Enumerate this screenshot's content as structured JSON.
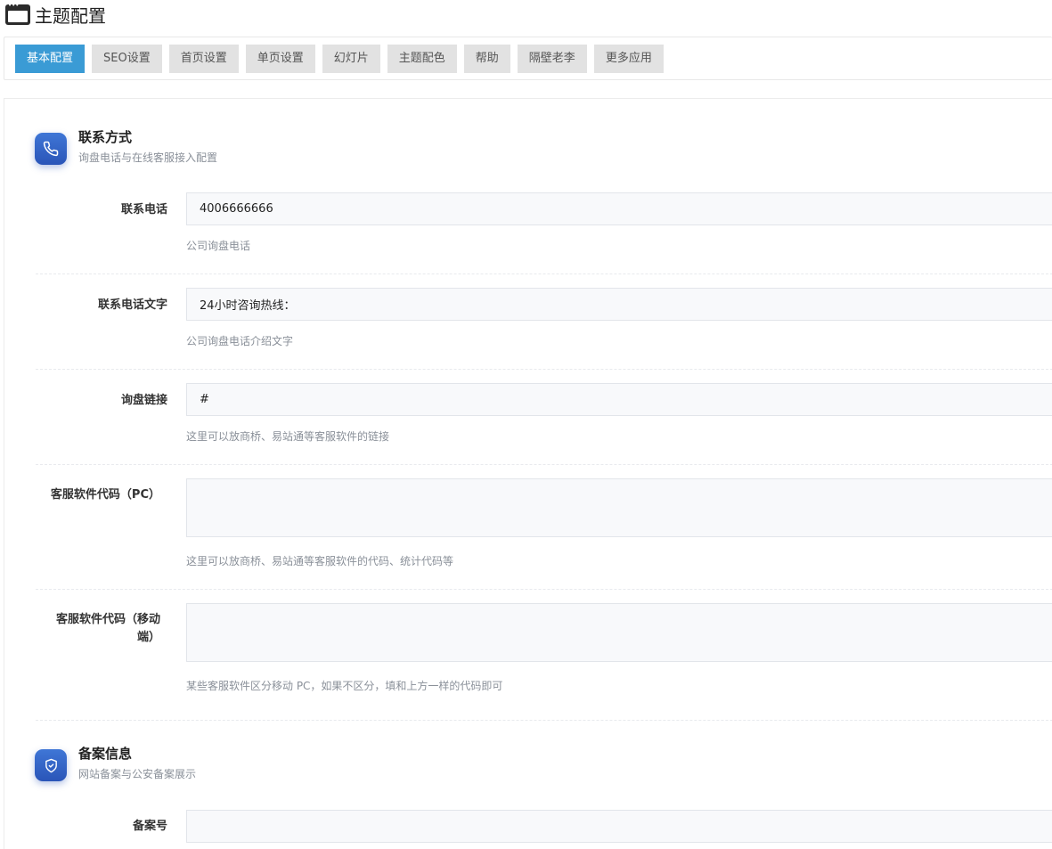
{
  "page": {
    "title": "主题配置",
    "icon": "browser-window-icon"
  },
  "tabs": [
    {
      "label": "基本配置",
      "active": true
    },
    {
      "label": "SEO设置"
    },
    {
      "label": "首页设置"
    },
    {
      "label": "单页设置"
    },
    {
      "label": "幻灯片"
    },
    {
      "label": "主题配色"
    },
    {
      "label": "帮助"
    },
    {
      "label": "隔壁老李"
    },
    {
      "label": "更多应用"
    }
  ],
  "sections": {
    "contact": {
      "title": "联系方式",
      "desc": "询盘电话与在线客服接入配置",
      "icon": "phone-icon"
    },
    "record": {
      "title": "备案信息",
      "desc": "网站备案与公安备案展示",
      "icon": "shield-check-icon"
    }
  },
  "fields": {
    "phone": {
      "label": "联系电话",
      "value": "4006666666",
      "hint": "公司询盘电话"
    },
    "phone_text": {
      "label": "联系电话文字",
      "value": "24小时咨询热线：",
      "hint": "公司询盘电话介绍文字"
    },
    "inquiry_link": {
      "label": "询盘链接",
      "value": "#",
      "hint": "这里可以放商桥、易站通等客服软件的链接"
    },
    "cs_code_pc": {
      "label": "客服软件代码（PC）",
      "value": "",
      "hint": "这里可以放商桥、易站通等客服软件的代码、统计代码等"
    },
    "cs_code_mobile": {
      "label_line1": "客服软件代码（移动",
      "label_line2": "端）",
      "value": "",
      "hint": "某些客服软件区分移动 PC，如果不区分，填和上方一样的代码即可"
    },
    "record_no": {
      "label": "备案号",
      "value": ""
    }
  },
  "colors": {
    "active_tab": "#3a9bd5",
    "section_icon": "#2f5fc4"
  }
}
